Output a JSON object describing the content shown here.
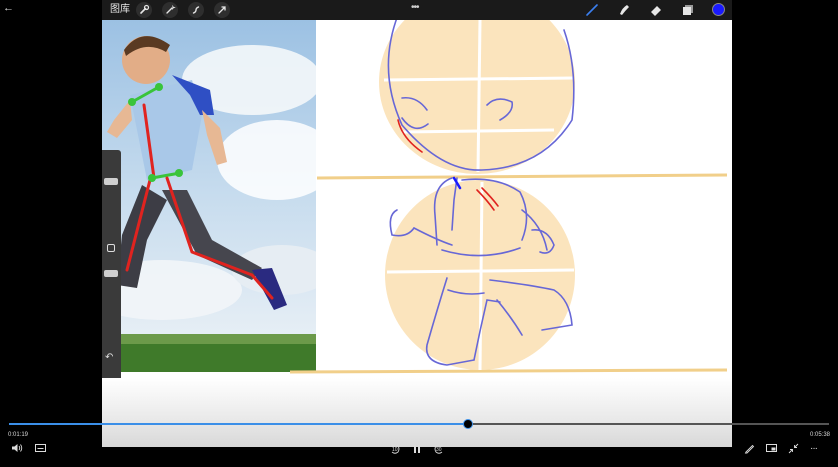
{
  "app": {
    "gallery_label": "图库",
    "toolbar_left": [
      "wrench-icon",
      "magic-wand-icon",
      "selection-icon",
      "transform-arrow-icon"
    ],
    "toolbar_right": [
      "brush-icon",
      "smudge-icon",
      "eraser-icon",
      "layers-icon"
    ],
    "active_color": "#1a1aff"
  },
  "player": {
    "elapsed": "0:01:19",
    "duration": "0:05:38",
    "progress": 0.56,
    "skip_back_label": "10",
    "skip_forward_label": "30",
    "accent": "#3b8fe8"
  }
}
